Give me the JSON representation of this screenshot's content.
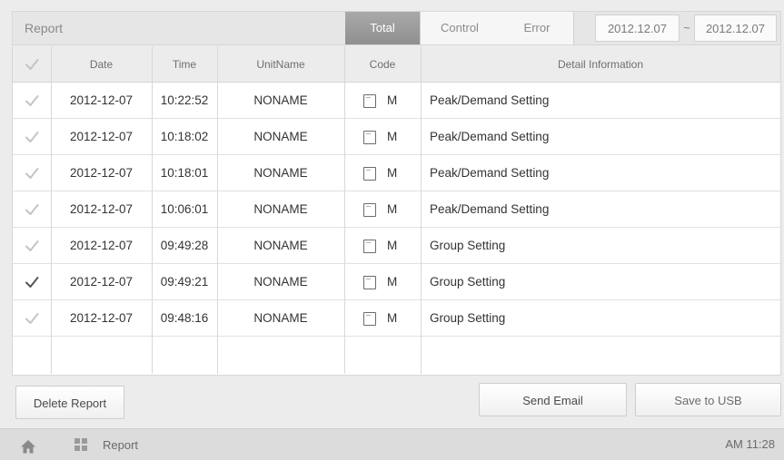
{
  "header": {
    "title": "Report",
    "tabs": {
      "total": "Total",
      "control": "Control",
      "error": "Error"
    },
    "date_from": "2012.12.07",
    "date_separator": "~",
    "date_to": "2012.12.07"
  },
  "table": {
    "columns": {
      "date": "Date",
      "time": "Time",
      "unit_name": "UnitName",
      "code": "Code",
      "detail": "Detail Information"
    },
    "rows": [
      {
        "date": "2012-12-07",
        "time": "10:22:52",
        "unit_name": "NONAME",
        "code": "M",
        "detail": "Peak/Demand Setting",
        "checked": false
      },
      {
        "date": "2012-12-07",
        "time": "10:18:02",
        "unit_name": "NONAME",
        "code": "M",
        "detail": "Peak/Demand Setting",
        "checked": false
      },
      {
        "date": "2012-12-07",
        "time": "10:18:01",
        "unit_name": "NONAME",
        "code": "M",
        "detail": "Peak/Demand Setting",
        "checked": false
      },
      {
        "date": "2012-12-07",
        "time": "10:06:01",
        "unit_name": "NONAME",
        "code": "M",
        "detail": "Peak/Demand Setting",
        "checked": false
      },
      {
        "date": "2012-12-07",
        "time": "09:49:28",
        "unit_name": "NONAME",
        "code": "M",
        "detail": "Group Setting",
        "checked": false
      },
      {
        "date": "2012-12-07",
        "time": "09:49:21",
        "unit_name": "NONAME",
        "code": "M",
        "detail": "Group Setting",
        "checked": true
      },
      {
        "date": "2012-12-07",
        "time": "09:48:16",
        "unit_name": "NONAME",
        "code": "M",
        "detail": "Group Setting",
        "checked": false
      }
    ]
  },
  "buttons": {
    "delete": "Delete Report",
    "send_email": "Send Email",
    "save_usb": "Save to USB"
  },
  "footer": {
    "breadcrumb": "Report",
    "clock": "AM 11:28"
  },
  "icons": {
    "home": "home-icon",
    "menu": "grid-icon",
    "check": "check-icon",
    "code": "document-icon"
  },
  "colors": {
    "active_tab": "#9a9a9a",
    "check_light": "#c4c4c4",
    "check_dark": "#555555"
  }
}
